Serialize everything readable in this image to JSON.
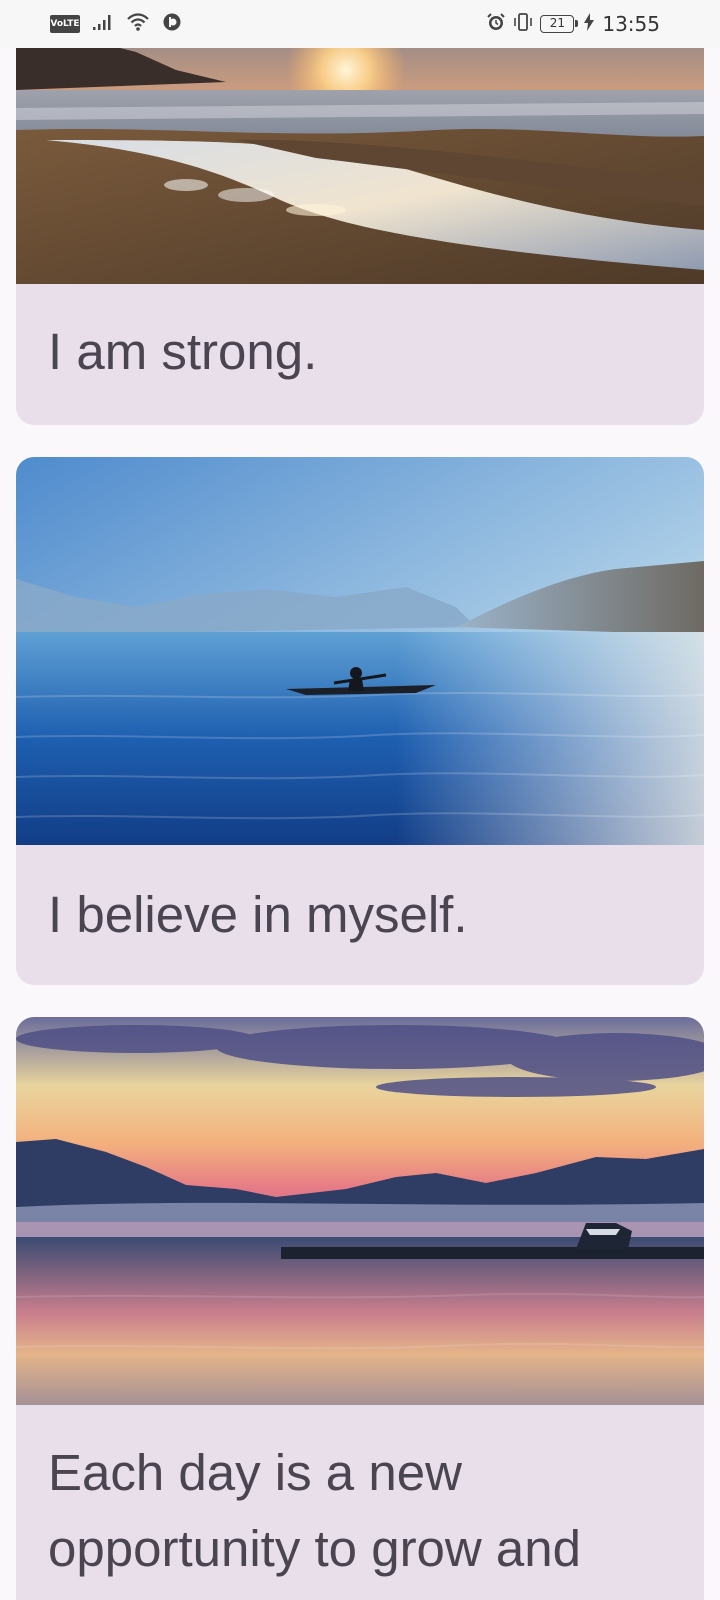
{
  "status_bar": {
    "network_badge": "VoLTE",
    "battery_level": "21",
    "time": "13:55",
    "icons": [
      "signal-icon",
      "wifi-icon",
      "data-saver-icon",
      "alarm-icon",
      "vibrate-icon",
      "battery-icon",
      "charging-icon"
    ]
  },
  "feed": {
    "cards": [
      {
        "caption": "I am strong.",
        "image": "beach-sunset-tidal-stream"
      },
      {
        "caption": "I believe in myself.",
        "image": "kayaker-on-blue-lake"
      },
      {
        "caption": "Each day is a new opportunity to grow and",
        "image": "mountain-lake-sunset-pier"
      }
    ]
  },
  "colors": {
    "background": "#fbf8fc",
    "card": "#e8dfeb",
    "caption_text": "#4a4550",
    "status_text": "#333333"
  }
}
